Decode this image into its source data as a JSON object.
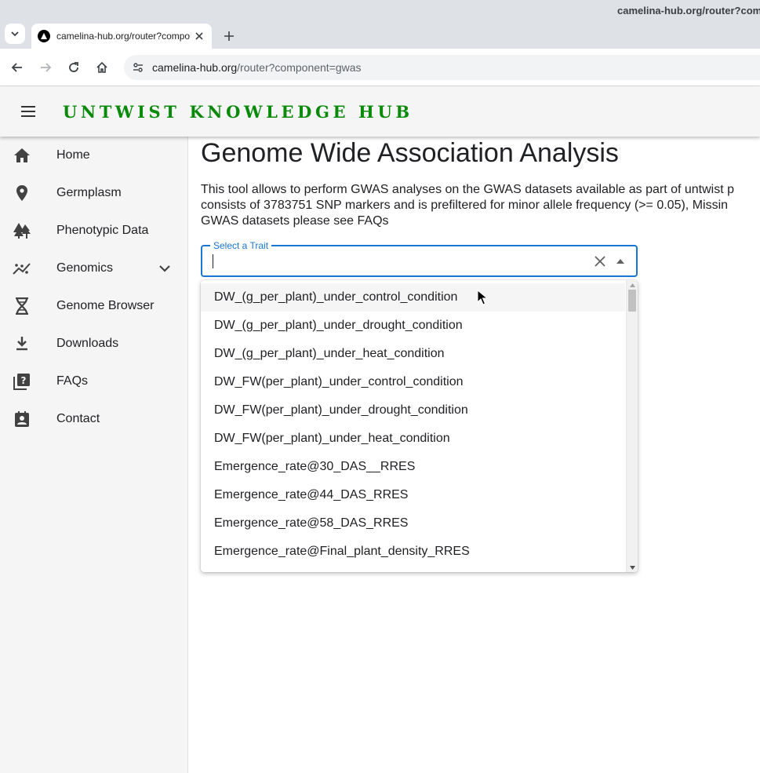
{
  "browser": {
    "window_title": "camelina-hub.org/router?com",
    "tab_title": "camelina-hub.org/router?component=gwas",
    "url_host": "camelina-hub.org",
    "url_path": "/router?component=gwas"
  },
  "app": {
    "brand": "UNTWIST KNOWLEDGE HUB",
    "brand_color": "#0a8a0a"
  },
  "sidebar": {
    "items": [
      {
        "label": "Home",
        "icon": "home-icon"
      },
      {
        "label": "Germplasm",
        "icon": "location-pin-icon"
      },
      {
        "label": "Phenotypic Data",
        "icon": "forest-icon"
      },
      {
        "label": "Genomics",
        "icon": "scatter-chart-icon",
        "expandable": true
      },
      {
        "label": "Genome Browser",
        "icon": "dna-icon"
      },
      {
        "label": "Downloads",
        "icon": "download-icon"
      },
      {
        "label": "FAQs",
        "icon": "quiz-icon"
      },
      {
        "label": "Contact",
        "icon": "contact-icon"
      }
    ]
  },
  "main": {
    "title": "Genome Wide Association Analysis",
    "description_lines": [
      "This tool allows to perform GWAS analyses on the GWAS datasets available as part of untwist p",
      "consists of 3783751 SNP markers and is prefiltered for minor allele frequency (>= 0.05), Missin",
      "GWAS datasets please see FAQs"
    ],
    "trait_select": {
      "label": "Select a Trait",
      "value": "",
      "accent": "#1976d2",
      "options": [
        "DW_(g_per_plant)_under_control_condition",
        "DW_(g_per_plant)_under_drought_condition",
        "DW_(g_per_plant)_under_heat_condition",
        "DW_FW(per_plant)_under_control_condition",
        "DW_FW(per_plant)_under_drought_condition",
        "DW_FW(per_plant)_under_heat_condition",
        "Emergence_rate@30_DAS__RRES",
        "Emergence_rate@44_DAS_RRES",
        "Emergence_rate@58_DAS_RRES",
        "Emergence_rate@Final_plant_density_RRES"
      ]
    }
  }
}
